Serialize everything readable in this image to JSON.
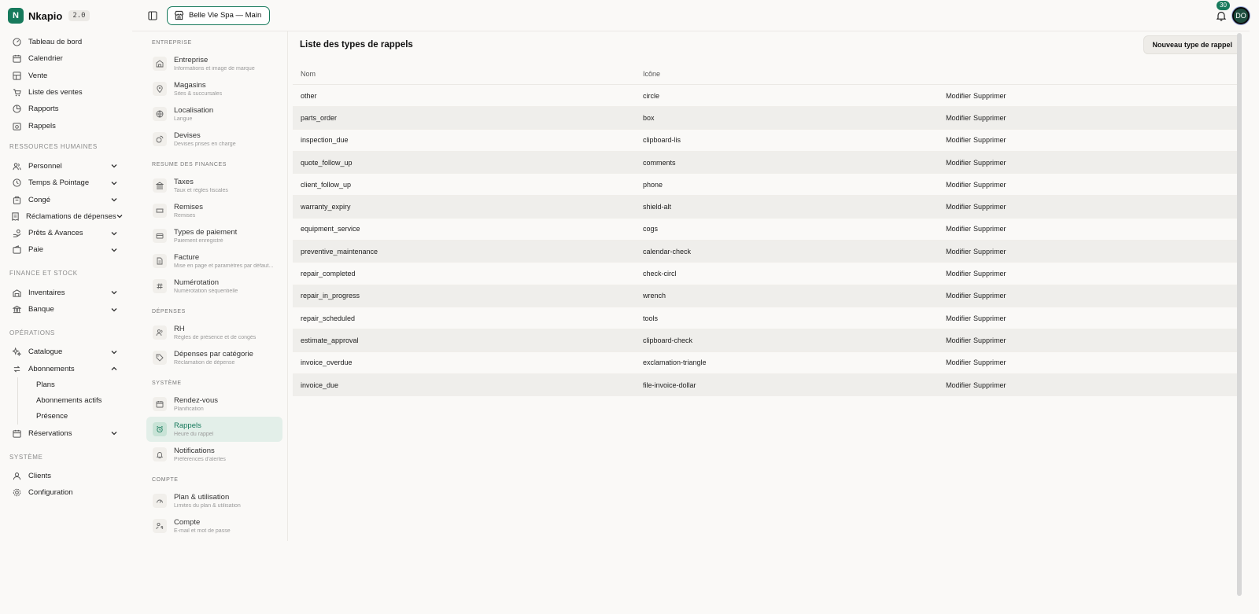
{
  "brand": {
    "name": "Nkapio",
    "version": "2.0",
    "logo_letter": "N",
    "accent": "#177a5c"
  },
  "sidebar": {
    "main": [
      {
        "label": "Tableau de bord",
        "icon": "dashboard-icon"
      },
      {
        "label": "Calendrier",
        "icon": "calendar-icon"
      },
      {
        "label": "Vente",
        "icon": "pos-icon"
      },
      {
        "label": "Liste des ventes",
        "icon": "cart-icon"
      },
      {
        "label": "Rapports",
        "icon": "chart-icon"
      },
      {
        "label": "Rappels",
        "icon": "bell-calendar-icon"
      }
    ],
    "sections": {
      "rh": "RESSOURCES HUMAINES",
      "finance": "FINANCE ET STOCK",
      "ops": "OPÉRATIONS",
      "system": "SYSTÈME"
    },
    "rh_items": [
      {
        "label": "Personnel"
      },
      {
        "label": "Temps & Pointage"
      },
      {
        "label": "Congé"
      },
      {
        "label": "Réclamations de dépenses"
      },
      {
        "label": "Prêts & Avances"
      },
      {
        "label": "Paie"
      }
    ],
    "finance_items": [
      {
        "label": "Inventaires"
      },
      {
        "label": "Banque"
      }
    ],
    "ops_items": {
      "catalogue": "Catalogue",
      "abonnements": "Abonnements",
      "sub": [
        "Plans",
        "Abonnements actifs",
        "Présence"
      ],
      "reservations": "Réservations"
    },
    "system_items": [
      {
        "label": "Clients"
      },
      {
        "label": "Configuration"
      }
    ]
  },
  "topbar": {
    "store": "Belle Vie Spa — Main",
    "notifications": "30",
    "avatar": "DO"
  },
  "settings": {
    "entreprise": "ENTREPRISE",
    "entreprise_items": [
      {
        "title": "Entreprise",
        "sub": "Informations et image de marque"
      },
      {
        "title": "Magasins",
        "sub": "Sites & succursales"
      },
      {
        "title": "Localisation",
        "sub": "Langue"
      },
      {
        "title": "Devises",
        "sub": "Devises prises en charge"
      }
    ],
    "finances": "RESUME DES FINANCES",
    "finances_items": [
      {
        "title": "Taxes",
        "sub": "Taux et règles fiscales"
      },
      {
        "title": "Remises",
        "sub": "Remises"
      },
      {
        "title": "Types de paiement",
        "sub": "Paiement enregistré"
      },
      {
        "title": "Facture",
        "sub": "Mise en page et paramètres par défaut..."
      },
      {
        "title": "Numérotation",
        "sub": "Numérotation séquentielle"
      }
    ],
    "depenses": "DÉPENSES",
    "depenses_items": [
      {
        "title": "RH",
        "sub": "Règles de présence et de congés"
      },
      {
        "title": "Dépenses par catégorie",
        "sub": "Réclamation de dépense"
      }
    ],
    "systeme": "SYSTÈME",
    "systeme_items": [
      {
        "title": "Rendez-vous",
        "sub": "Planification"
      },
      {
        "title": "Rappels",
        "sub": "Heure du rappel"
      },
      {
        "title": "Notifications",
        "sub": "Préférences d'alertes"
      }
    ],
    "compte": "COMPTE",
    "compte_items": [
      {
        "title": "Plan & utilisation",
        "sub": "Limites du plan & utilisation"
      },
      {
        "title": "Compte",
        "sub": "E-mail et mot de passe"
      }
    ]
  },
  "main": {
    "title": "Liste des types de rappels",
    "new_button": "Nouveau type de rappel",
    "columns": [
      "Nom",
      "Icône"
    ],
    "edit_label": "Modifier",
    "delete_label": "Supprimer",
    "rows": [
      {
        "name": "other",
        "icon": "circle"
      },
      {
        "name": "parts_order",
        "icon": "box"
      },
      {
        "name": "inspection_due",
        "icon": "clipboard-lis"
      },
      {
        "name": "quote_follow_up",
        "icon": "comments"
      },
      {
        "name": "client_follow_up",
        "icon": "phone"
      },
      {
        "name": "warranty_expiry",
        "icon": "shield-alt"
      },
      {
        "name": "equipment_service",
        "icon": "cogs"
      },
      {
        "name": "preventive_maintenance",
        "icon": "calendar-check"
      },
      {
        "name": "repair_completed",
        "icon": "check-circl"
      },
      {
        "name": "repair_in_progress",
        "icon": "wrench"
      },
      {
        "name": "repair_scheduled",
        "icon": "tools"
      },
      {
        "name": "estimate_approval",
        "icon": "clipboard-check"
      },
      {
        "name": "invoice_overdue",
        "icon": "exclamation-triangle"
      },
      {
        "name": "invoice_due",
        "icon": "file-invoice-dollar"
      }
    ]
  }
}
